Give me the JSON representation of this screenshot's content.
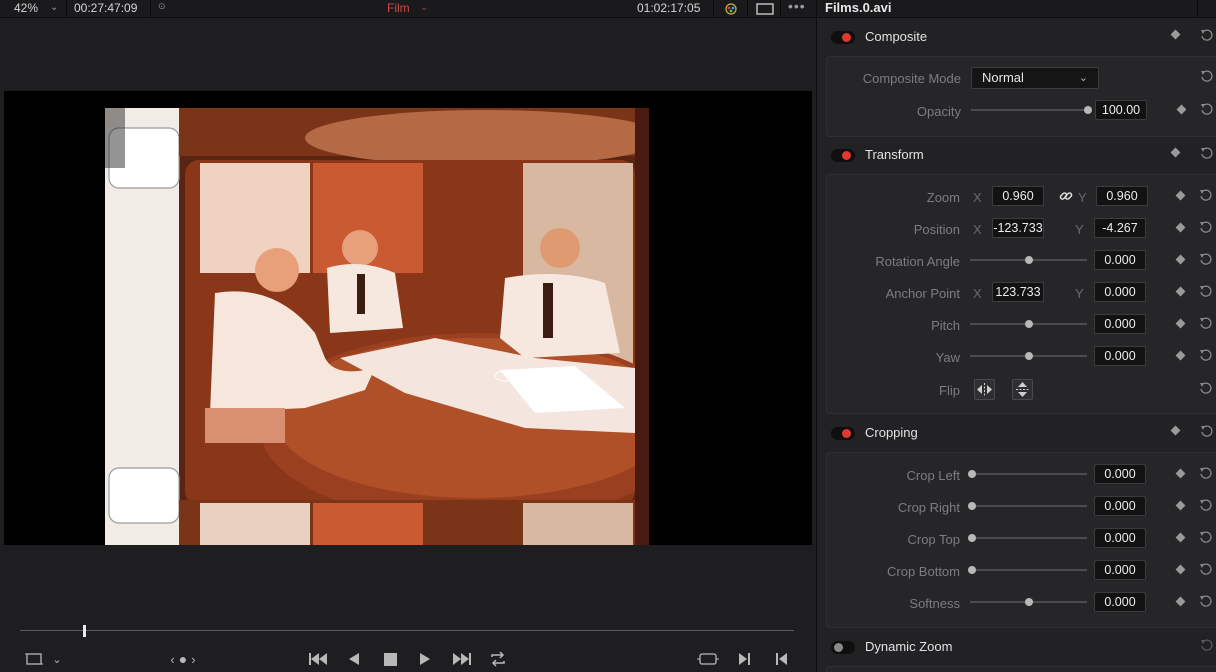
{
  "viewer": {
    "zoom": "42%",
    "source_timecode": "00:27:47:09",
    "timeline_name": "Film",
    "record_timecode": "01:02:17:05",
    "playhead_position": 0.083
  },
  "icons": {
    "zoom_menu": "chevron-down-icon",
    "timeline_menu": "chevron-down-icon",
    "fx": "color-effects-icon",
    "view_mode": "frame-view-icon",
    "more": "ellipsis-icon",
    "safe_area": "crop-frame-icon",
    "nav": "nav-dots-icon",
    "transport": [
      "skip-to-start-icon",
      "play-reverse-icon",
      "stop-icon",
      "play-icon",
      "skip-to-end-icon",
      "loop-icon"
    ],
    "right": [
      "match-frame-icon",
      "next-clip-icon",
      "prev-clip-icon"
    ]
  },
  "inspector": {
    "clip_name": "Films.0.avi",
    "composite": {
      "title": "Composite",
      "enabled": true,
      "mode_label": "Composite Mode",
      "mode_value": "Normal",
      "opacity_label": "Opacity",
      "opacity_value": "100.00",
      "opacity_fraction": 1.0
    },
    "transform": {
      "title": "Transform",
      "enabled": true,
      "zoom_label": "Zoom",
      "zoom_x": "0.960",
      "zoom_y": "0.960",
      "position_label": "Position",
      "position_x": "-123.733",
      "position_y": "-4.267",
      "rotation_label": "Rotation Angle",
      "rotation_value": "0.000",
      "anchor_label": "Anchor Point",
      "anchor_x": "123.733",
      "anchor_y": "0.000",
      "pitch_label": "Pitch",
      "pitch_value": "0.000",
      "yaw_label": "Yaw",
      "yaw_value": "0.000",
      "flip_label": "Flip",
      "axis_x": "X",
      "axis_y": "Y"
    },
    "cropping": {
      "title": "Cropping",
      "enabled": true,
      "crop_left_label": "Crop Left",
      "crop_left_value": "0.000",
      "crop_right_label": "Crop Right",
      "crop_right_value": "0.000",
      "crop_top_label": "Crop Top",
      "crop_top_value": "0.000",
      "crop_bottom_label": "Crop Bottom",
      "crop_bottom_value": "0.000",
      "softness_label": "Softness",
      "softness_value": "0.000"
    },
    "dynamic_zoom": {
      "title": "Dynamic Zoom",
      "enabled": false
    }
  },
  "colors": {
    "accent_red": "#e0392f",
    "timeline_name": "#d04848",
    "panel_bg": "#222224",
    "viewer_bg": "#1e1e20"
  }
}
